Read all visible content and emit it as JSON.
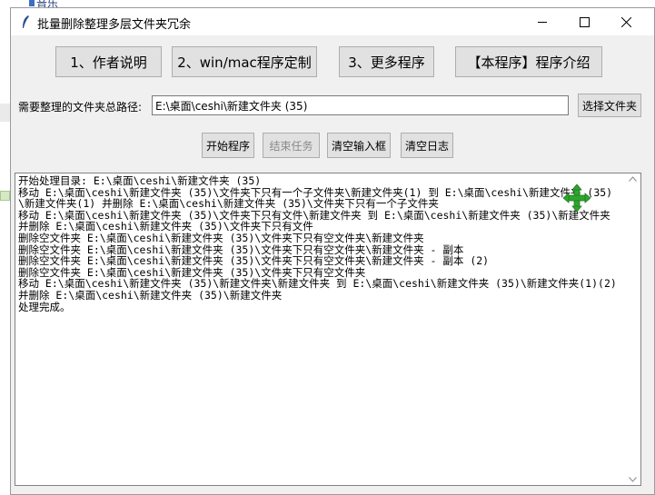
{
  "background": {
    "text": "音乐"
  },
  "window": {
    "title": "批量删除整理多层文件夹冗余",
    "controls": {
      "minimize": "minimize-icon",
      "maximize": "maximize-icon",
      "close": "close-icon"
    }
  },
  "top_buttons": [
    {
      "label": "1、作者说明"
    },
    {
      "label": "2、win/mac程序定制"
    },
    {
      "label": "3、更多程序"
    },
    {
      "label": "【本程序】程序介绍"
    }
  ],
  "path": {
    "label": "需要整理的文件夹总路径:",
    "value": "E:\\桌面\\ceshi\\新建文件夹 (35)",
    "choose_label": "选择文件夹"
  },
  "actions": {
    "start": "开始程序",
    "stop": "结束任务",
    "clear_input": "清空输入框",
    "clear_log": "清空日志"
  },
  "log": {
    "text": "开始处理目录: E:\\桌面\\ceshi\\新建文件夹 (35)\n移动 E:\\桌面\\ceshi\\新建文件夹 (35)\\文件夹下只有一个子文件夹\\新建文件夹(1) 到 E:\\桌面\\ceshi\\新建文件夹 (35)\\新建文件夹(1) 并删除 E:\\桌面\\ceshi\\新建文件夹 (35)\\文件夹下只有一个子文件夹\n移动 E:\\桌面\\ceshi\\新建文件夹 (35)\\文件夹下只有文件\\新建文件夹 到 E:\\桌面\\ceshi\\新建文件夹 (35)\\新建文件夹 并删除 E:\\桌面\\ceshi\\新建文件夹 (35)\\文件夹下只有文件\n删除空文件夹 E:\\桌面\\ceshi\\新建文件夹 (35)\\文件夹下只有空文件夹\\新建文件夹\n删除空文件夹 E:\\桌面\\ceshi\\新建文件夹 (35)\\文件夹下只有空文件夹\\新建文件夹 - 副本\n删除空文件夹 E:\\桌面\\ceshi\\新建文件夹 (35)\\文件夹下只有空文件夹\\新建文件夹 - 副本 (2)\n删除空文件夹 E:\\桌面\\ceshi\\新建文件夹 (35)\\文件夹下只有空文件夹\n移动 E:\\桌面\\ceshi\\新建文件夹 (35)\\新建文件夹\\新建文件夹 到 E:\\桌面\\ceshi\\新建文件夹 (35)\\新建文件夹(1)(2) 并删除 E:\\桌面\\ceshi\\新建文件夹 (35)\\新建文件夹\n处理完成。"
  },
  "cursor": {
    "icon": "move-cursor-icon",
    "color": "#2fa52f"
  }
}
